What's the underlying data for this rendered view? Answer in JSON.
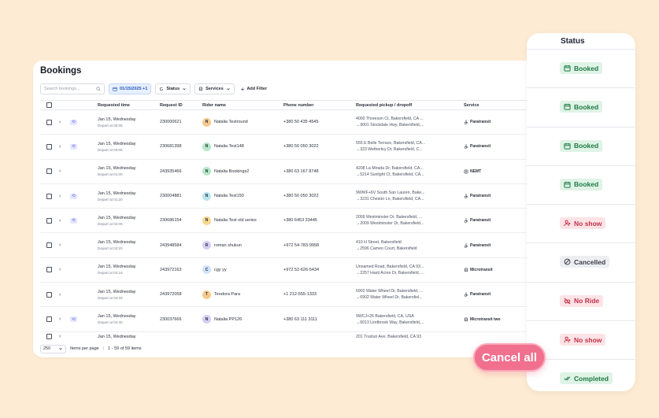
{
  "page_title": "Bookings",
  "search": {
    "placeholder": "Search bookings..."
  },
  "filters": {
    "date": "01/15/2025 +1",
    "status": "Status",
    "services": "Services",
    "add_filter": "Add Filter"
  },
  "columns": {
    "requested_time": "Requested time",
    "request_id": "Request ID",
    "rider_name": "Rider name",
    "phone": "Phone number",
    "pickup": "Requested pickup / dropoff",
    "service": "Service"
  },
  "rows": [
    {
      "date": "Jan 15, Wednesday",
      "depart": "Depart at 00:05",
      "id": "230000621",
      "initial": "N",
      "avatar_color": "#f7c98e",
      "rider": "Natalia Testround",
      "phone": "+380 50 435 4545",
      "pickup": "4000 Thoreson Ct, Bakersfield, CA ...",
      "dropoff": "9001 Stockdale Hwy, Bakersfield,...",
      "service": "Paratransit",
      "service_icon": "wheelchair-icon",
      "recurring": true
    },
    {
      "date": "Jan 15, Wednesday",
      "depart": "Depart at 00:05",
      "id": "230681398",
      "initial": "N",
      "avatar_color": "#b6e7c9",
      "rider": "Natalia Test148",
      "phone": "+380 50 050 3022",
      "pickup": "555 E Belle Terrace, Bakersfield, CA...",
      "dropoff": "323 Wetherley Dr, Bakersfield, C...",
      "service": "Paratransit",
      "service_icon": "wheelchair-icon",
      "recurring": true
    },
    {
      "date": "Jan 15, Wednesday",
      "depart": "Depart at 01:00",
      "id": "243935466",
      "initial": "N",
      "avatar_color": "#b6e7c9",
      "rider": "Natalia Bookings2",
      "phone": "+380 63 167 8748",
      "pickup": "4208 La Mirada Dr, Bakersfield, CA...",
      "dropoff": "5214 Sunlight Ct, Bakersfield, CA...",
      "service": "NEMT",
      "service_icon": "medical-icon",
      "recurring": false
    },
    {
      "date": "Jan 15, Wednesday",
      "depart": "Depart at 01:20",
      "id": "230004881",
      "initial": "N",
      "avatar_color": "#b9e4ef",
      "rider": "Natalia Test150",
      "phone": "+380 50 050 3022",
      "pickup": "9WWF+6V South San Lauren, Bake...",
      "dropoff": "3231 Chester Ln, Bakersfield, CA...",
      "service": "Paratransit",
      "service_icon": "wheelchair-icon",
      "recurring": true
    },
    {
      "date": "Jan 15, Wednesday",
      "depart": "Depart at 02:05",
      "id": "230686154",
      "initial": "N",
      "avatar_color": "#f7d88e",
      "rider": "Natalia Test old series",
      "phone": "+380 6453 33445",
      "pickup": "2009 Westminster Dr, Bakersfield, ...",
      "dropoff": "2009 Westminster Dr, Bakersfield...",
      "service": "Paratransit",
      "service_icon": "wheelchair-icon",
      "recurring": true
    },
    {
      "date": "Jan 15, Wednesday",
      "depart": "Depart at 02:20",
      "id": "243948584",
      "initial": "R",
      "avatar_color": "#d6cdf5",
      "rider": "roman shukun",
      "phone": "+972 54-783-9958",
      "pickup": "410 H Street, Bakersfield",
      "dropoff": "2596 Cameo Court, Bakersfield",
      "service": "Paratransit",
      "service_icon": "wheelchair-icon",
      "recurring": false
    },
    {
      "date": "Jan 15, Wednesday",
      "depart": "Depart at 04:16",
      "id": "243972163",
      "initial": "C",
      "avatar_color": "#cfe3fb",
      "rider": "cgy yy",
      "phone": "+972 52-626-5434",
      "pickup": "Unnamed Road, Bakersfield, CA 93...",
      "dropoff": "2257 Hasti Acres Dr, Bakersfield, ...",
      "service": "Microtransit",
      "service_icon": "bus-icon",
      "recurring": false
    },
    {
      "date": "Jan 15, Wednesday",
      "depart": "Depart at 04:25",
      "id": "243972058",
      "initial": "T",
      "avatar_color": "#f7c98e",
      "rider": "Teodora Para",
      "phone": "+1 212-555-1333",
      "pickup": "6902 Water Wheel Dr, Bakersfield, ...",
      "dropoff": "6902 Water Wheel Dr, Bakersfiel...",
      "service": "Paratransit",
      "service_icon": "wheelchair-icon",
      "recurring": false
    },
    {
      "date": "Jan 15, Wednesday",
      "depart": "Depart at 04:40",
      "id": "230037666",
      "initial": "N",
      "avatar_color": "#d6cdf5",
      "rider": "Natalia PP126",
      "phone": "+380 63 111 3111",
      "pickup": "9WCJ+26 Bakersfield, CA, USA",
      "dropoff": "6013 Lindbrook Way, Bakersfield,...",
      "service": "Microtransit two",
      "service_icon": "bus-icon",
      "recurring": true
    },
    {
      "date": "Jan 15, Wednesday",
      "depart": "",
      "id": "",
      "initial": "",
      "avatar_color": "#b6e7c9",
      "rider": "",
      "phone": "",
      "pickup": "201 Truxtun Ave, Bakersfield, CA 93",
      "dropoff": "",
      "service": "",
      "service_icon": "",
      "recurring": false
    }
  ],
  "footer": {
    "per_page_value": "250",
    "per_page_label": "Items per page",
    "range": "1 - 59 of 59 items"
  },
  "status_panel": {
    "header": "Status",
    "items": [
      {
        "label": "Booked",
        "icon": "calendar-icon",
        "bg": "#dff3e6",
        "fg": "#1f7a45"
      },
      {
        "label": "Booked",
        "icon": "calendar-icon",
        "bg": "#dff3e6",
        "fg": "#1f7a45"
      },
      {
        "label": "Booked",
        "icon": "calendar-icon",
        "bg": "#dff3e6",
        "fg": "#1f7a45"
      },
      {
        "label": "Booked",
        "icon": "calendar-icon",
        "bg": "#dff3e6",
        "fg": "#1f7a45"
      },
      {
        "label": "No show",
        "icon": "user-x-icon",
        "bg": "#fde3e6",
        "fg": "#c2324b"
      },
      {
        "label": "Cancelled",
        "icon": "cancel-icon",
        "bg": "#eceef2",
        "fg": "#3a3f4b"
      },
      {
        "label": "No Ride",
        "icon": "no-car-icon",
        "bg": "#fde3e6",
        "fg": "#c2324b"
      },
      {
        "label": "No show",
        "icon": "user-x-icon",
        "bg": "#fde3e6",
        "fg": "#c2324b"
      },
      {
        "label": "Completed",
        "icon": "double-check-icon",
        "bg": "#dff3e6",
        "fg": "#1f7a45"
      }
    ]
  },
  "cancel_all": "Cancel all"
}
